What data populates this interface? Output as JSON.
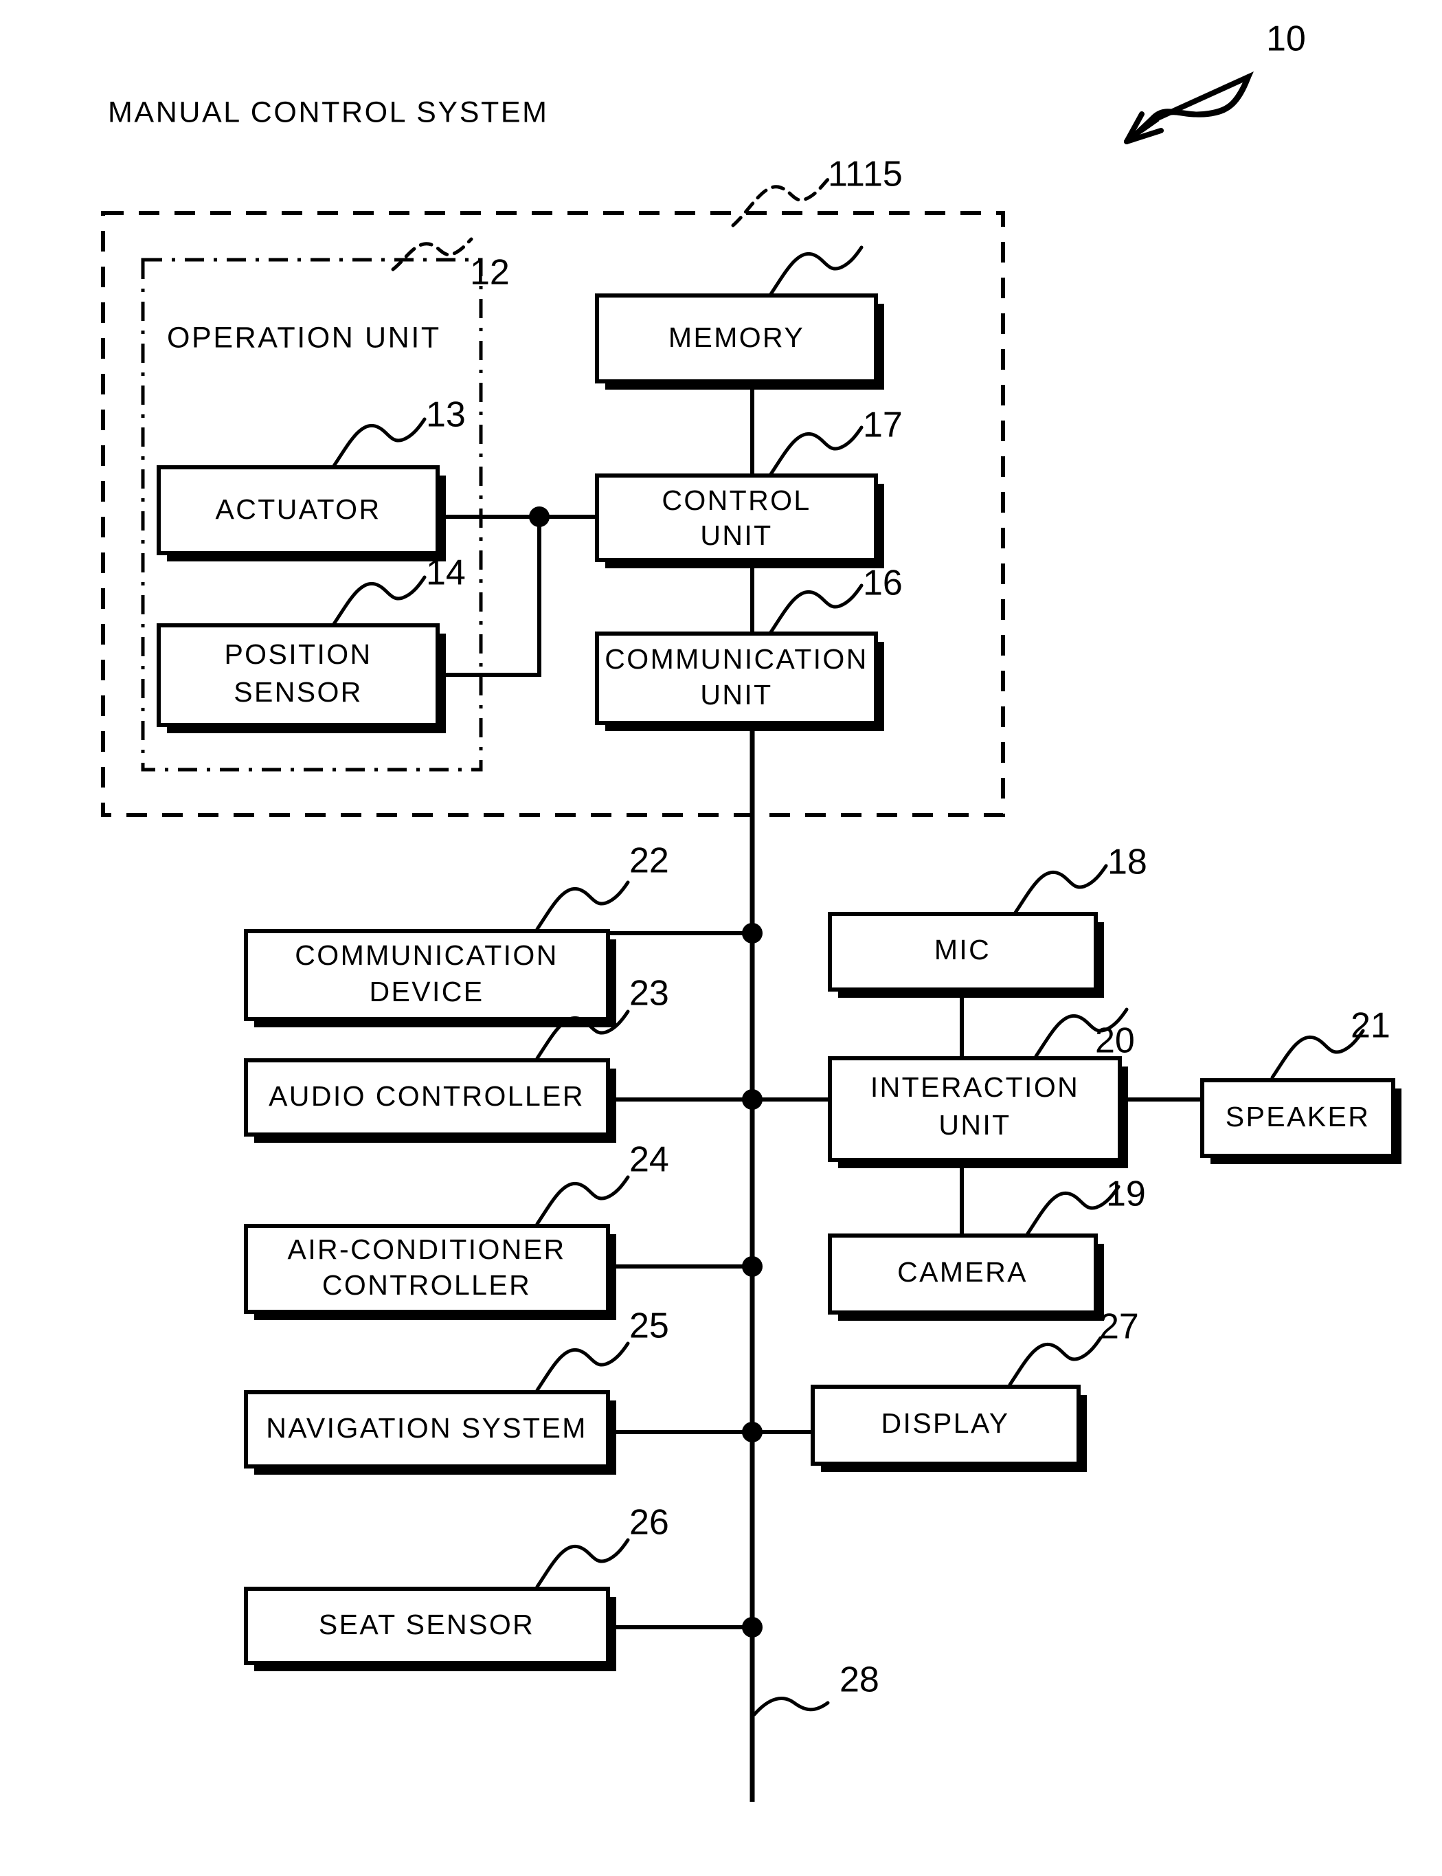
{
  "figure": {
    "overall_ref": "10",
    "system_group": {
      "title": "MANUAL CONTROL SYSTEM",
      "ref": "11"
    },
    "operation_unit_group": {
      "title": "OPERATION UNIT",
      "ref": "12"
    },
    "bus": {
      "ref": "28"
    },
    "blocks": {
      "actuator": {
        "label": "ACTUATOR",
        "ref": "13"
      },
      "position_sensor": {
        "label_line1": "POSITION",
        "label_line2": "SENSOR",
        "ref": "14"
      },
      "memory": {
        "label": "MEMORY",
        "ref": "15"
      },
      "communication_unit": {
        "label_line1": "COMMUNICATION",
        "label_line2": "UNIT",
        "ref": "16"
      },
      "control_unit": {
        "label_line1": "CONTROL",
        "label_line2": "UNIT",
        "ref": "17"
      },
      "mic": {
        "label": "MIC",
        "ref": "18"
      },
      "camera": {
        "label": "CAMERA",
        "ref": "19"
      },
      "interaction_unit": {
        "label_line1": "INTERACTION",
        "label_line2": "UNIT",
        "ref": "20"
      },
      "speaker": {
        "label": "SPEAKER",
        "ref": "21"
      },
      "communication_device": {
        "label_line1": "COMMUNICATION",
        "label_line2": "DEVICE",
        "ref": "22"
      },
      "audio_controller": {
        "label": "AUDIO CONTROLLER",
        "ref": "23"
      },
      "air_conditioner_controller": {
        "label_line1": "AIR-CONDITIONER",
        "label_line2": "CONTROLLER",
        "ref": "24"
      },
      "navigation_system": {
        "label": "NAVIGATION SYSTEM",
        "ref": "25"
      },
      "seat_sensor": {
        "label": "SEAT SENSOR",
        "ref": "26"
      },
      "display": {
        "label": "DISPLAY",
        "ref": "27"
      }
    },
    "colors": {
      "ink": "#000000",
      "paper": "#ffffff"
    }
  }
}
